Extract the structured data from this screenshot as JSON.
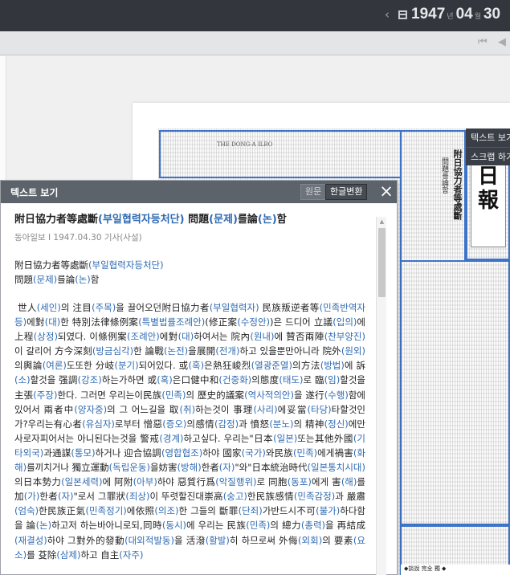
{
  "topbar": {
    "prev_icon": "chevron-left-icon",
    "calendar_icon": "calendar-grid-icon",
    "year": "1947",
    "year_unit": "년",
    "month": "04",
    "month_unit": "월",
    "day": "30"
  },
  "toolbar": {
    "first_page_icon": "skip-first-icon",
    "prev_page_icon": "prev-page-icon"
  },
  "newspaper": {
    "masthead_chars": [
      "日",
      "報"
    ],
    "vertical_headline": "附日協力者等處斷",
    "vertical_sub": "問題를論함",
    "header_line": "THE DONG-A ILBO",
    "bottom_text": "◆談說 完全 獨 ◆"
  },
  "tooltip": {
    "items": [
      "텍스트 보기",
      "스크랩 하기"
    ]
  },
  "panel": {
    "title": "텍스트 보기",
    "btn_original": "원문",
    "btn_hangul": "한글변환",
    "close_icon": "close-x-icon",
    "article": {
      "meta": "동아일보 I 1947.04.30 기사(사설)"
    }
  },
  "colors": {
    "topbar_bg": "#33373d",
    "panel_header_bg": "#5d636b",
    "hangul_highlight": "#2f6ab1",
    "selection_border": "#3d73c9"
  }
}
